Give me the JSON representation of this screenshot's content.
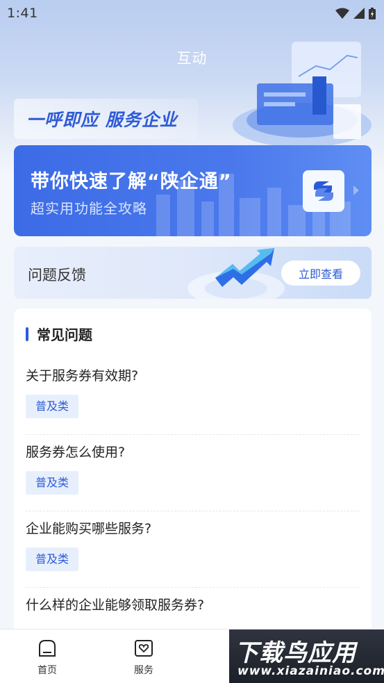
{
  "status": {
    "time": "1:41"
  },
  "page": {
    "title": "互动"
  },
  "hero": {
    "slogan": "一呼即应 服务企业"
  },
  "guide": {
    "title": "带你快速了解“陕企通”",
    "subtitle": "超实用功能全攻略"
  },
  "feedback": {
    "title": "问题反馈",
    "button": "立即查看"
  },
  "faq": {
    "heading": "常见问题",
    "items": [
      {
        "question": "关于服务券有效期?",
        "tag": "普及类"
      },
      {
        "question": "服务券怎么使用?",
        "tag": "普及类"
      },
      {
        "question": "企业能购买哪些服务?",
        "tag": "普及类"
      },
      {
        "question": "什么样的企业能够领取服务券?",
        "tag": ""
      }
    ]
  },
  "tabbar": {
    "items": [
      {
        "label": "首页",
        "icon": "home-icon"
      },
      {
        "label": "服务",
        "icon": "heart-icon"
      }
    ]
  },
  "watermark": {
    "main": "下载鸟应用",
    "sub": "www.xiazainiao.com"
  },
  "colors": {
    "accent": "#2a5bd7",
    "guide_bg": "#4a78ec"
  }
}
